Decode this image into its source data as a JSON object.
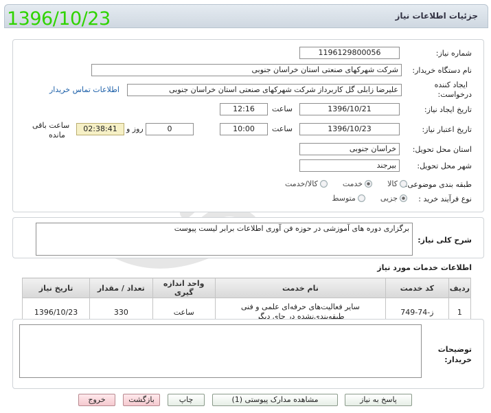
{
  "watermark_date": "1396/10/23",
  "page_title": "جزئیات اطلاعات نیاز",
  "form": {
    "need_number_label": "شماره نیاز:",
    "need_number": "1196129800056",
    "buyer_label": "نام دستگاه خریدار:",
    "buyer": "شرکت شهرکهای صنعتی استان خراسان جنوبی",
    "creator_label_1": "ایجاد کننده",
    "creator_label_2": "درخواست:",
    "creator": "علیرضا زابلی گل  کاربرداز شرکت شهرکهای صنعتی استان خراسان جنوبی",
    "contact_link": "اطلاعات تماس خریدار",
    "created_date_label": "تاریخ ایجاد نیاز:",
    "created_date": "1396/10/21",
    "time_label": "ساعت",
    "created_time": "12:16",
    "valid_date_label": "تاریخ اعتبار نیاز:",
    "valid_date": "1396/10/23",
    "valid_time": "10:00",
    "days_value": "0",
    "days_label": "روز و",
    "remaining": "02:38:41",
    "remaining_label_1": "ساعت باقی",
    "remaining_label_2": "مانده",
    "province_label": "استان محل تحویل:",
    "province": "خراسان جنوبی",
    "city_label": "شهر محل تحویل:",
    "city": "بیرجند",
    "category_label": "طبقه بندی موضوعی:",
    "category_options": [
      "کالا",
      "خدمت",
      "کالا/خدمت"
    ],
    "category_selected": "خدمت",
    "process_label": "نوع فرآیند خرید :",
    "process_options": [
      "جزیی",
      "متوسط"
    ],
    "process_selected": "جزیی"
  },
  "description": {
    "label": "شرح کلی نیاز:",
    "text": "برگزاری دوره های آموزشی در حوزه فن آوری اطلاعات برابر لیست پیوست"
  },
  "services": {
    "heading": "اطلاعات خدمات مورد نیاز",
    "columns": [
      "ردیف",
      "کد خدمت",
      "نام خدمت",
      "واحد اندازه گیری",
      "تعداد / مقدار",
      "تاریخ نیاز"
    ],
    "rows": [
      {
        "index": "1",
        "code": "ز-74-749",
        "name_line1": "سایر فعالیت‌های حرفه‌ای علمی و فنی",
        "name_line2": "طبقه‌بندی‌نشده در جای دیگر",
        "unit": "ساعت",
        "qty": "330",
        "date": "1396/10/23"
      }
    ]
  },
  "buyer_notes": {
    "label_1": "توضیحات",
    "label_2": "خریدار:",
    "text": ""
  },
  "buttons": {
    "reply": "پاسخ به نیاز",
    "attachments": "مشاهده مدارک پیوستی (1)",
    "print": "چاپ",
    "back": "بازگشت",
    "exit": "خروج"
  },
  "colors": {
    "watermark_green": "#2fd300",
    "link_blue": "#1a5ea8",
    "timer_bg": "#f6f0c6"
  }
}
